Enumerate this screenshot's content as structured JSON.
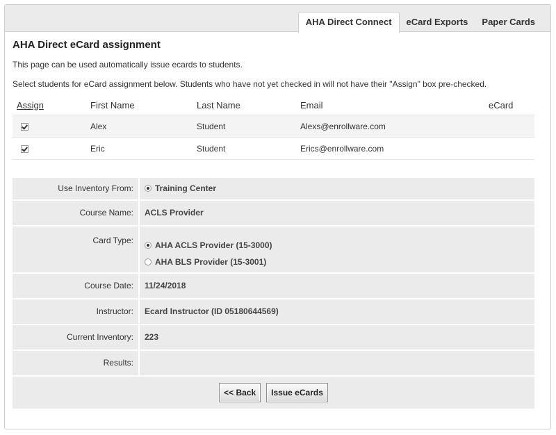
{
  "tabs": [
    {
      "label": "AHA Direct Connect",
      "active": true
    },
    {
      "label": "eCard Exports",
      "active": false
    },
    {
      "label": "Paper Cards",
      "active": false
    }
  ],
  "page": {
    "title": "AHA Direct eCard assignment",
    "intro": "This page can be used automatically issue ecards to students.",
    "instructions": "Select students for eCard assignment below. Students who have not yet checked in will not have their \"Assign\" box pre-checked."
  },
  "students_table": {
    "headers": {
      "assign": "Assign",
      "first_name": "First Name",
      "last_name": "Last Name",
      "email": "Email",
      "ecard": "eCard"
    },
    "rows": [
      {
        "assigned": true,
        "first_name": "Alex",
        "last_name": "Student",
        "email": "Alexs@enrollware.com",
        "ecard": ""
      },
      {
        "assigned": true,
        "first_name": "Eric",
        "last_name": "Student",
        "email": "Erics@enrollware.com",
        "ecard": ""
      }
    ]
  },
  "form": {
    "inventory": {
      "label": "Use Inventory From:",
      "option": "Training Center",
      "selected": true
    },
    "course_name": {
      "label": "Course Name:",
      "value": "ACLS Provider"
    },
    "card_type": {
      "label": "Card Type:",
      "options": [
        {
          "label": "AHA ACLS Provider (15-3000)",
          "selected": true
        },
        {
          "label": "AHA BLS Provider (15-3001)",
          "selected": false
        }
      ]
    },
    "course_date": {
      "label": "Course Date:",
      "value": "11/24/2018"
    },
    "instructor": {
      "label": "Instructor:",
      "value": "Ecard Instructor (ID 05180644569)"
    },
    "current_inventory": {
      "label": "Current Inventory:",
      "value": "223"
    },
    "results": {
      "label": "Results:",
      "value": ""
    }
  },
  "buttons": {
    "back": "<< Back",
    "issue": "Issue eCards"
  }
}
